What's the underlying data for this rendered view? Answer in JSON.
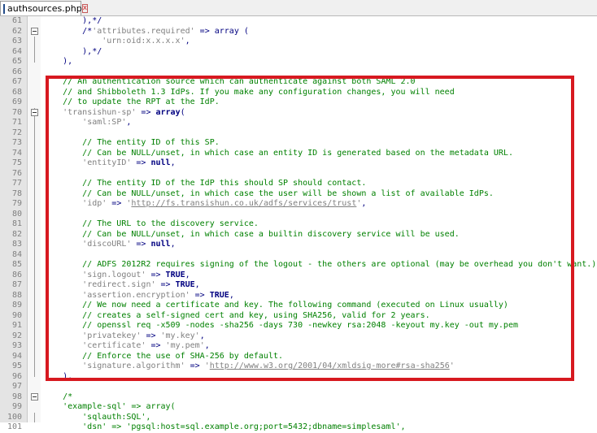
{
  "tab": {
    "title": "authsources.php",
    "close_glyph": "x"
  },
  "lines": [
    {
      "n": "61",
      "fold": "",
      "parts": [
        {
          "t": "        ),*/",
          "c": "op"
        }
      ]
    },
    {
      "n": "62",
      "fold": "open",
      "parts": [
        {
          "t": "        /*",
          "c": "op"
        },
        {
          "t": "'attributes.required'",
          "c": "str"
        },
        {
          "t": " => array (",
          "c": "op"
        }
      ]
    },
    {
      "n": "63",
      "fold": "",
      "parts": [
        {
          "t": "            ",
          "c": ""
        },
        {
          "t": "'urn:oid:x.x.x.x'",
          "c": "str"
        },
        {
          "t": ",",
          "c": "op"
        }
      ]
    },
    {
      "n": "64",
      "fold": "",
      "parts": [
        {
          "t": "        ),*/",
          "c": "op"
        }
      ]
    },
    {
      "n": "65",
      "fold": "",
      "parts": [
        {
          "t": "    ),",
          "c": "op"
        }
      ]
    },
    {
      "n": "66",
      "fold": "",
      "parts": []
    },
    {
      "n": "67",
      "fold": "",
      "parts": [
        {
          "t": "    // An authentication source which can authenticate against both SAML 2.0",
          "c": "cmt"
        }
      ]
    },
    {
      "n": "68",
      "fold": "",
      "parts": [
        {
          "t": "    // and Shibboleth 1.3 IdPs. If you make any configuration changes, you will need",
          "c": "cmt"
        }
      ]
    },
    {
      "n": "69",
      "fold": "",
      "parts": [
        {
          "t": "    // to update the RPT at the IdP.",
          "c": "cmt"
        }
      ]
    },
    {
      "n": "70",
      "fold": "open",
      "parts": [
        {
          "t": "    ",
          "c": ""
        },
        {
          "t": "'transishun-sp'",
          "c": "str"
        },
        {
          "t": " => ",
          "c": "op"
        },
        {
          "t": "array",
          "c": "kw"
        },
        {
          "t": "(",
          "c": "op"
        }
      ]
    },
    {
      "n": "71",
      "fold": "",
      "parts": [
        {
          "t": "        ",
          "c": ""
        },
        {
          "t": "'saml:SP'",
          "c": "str"
        },
        {
          "t": ",",
          "c": "op"
        }
      ]
    },
    {
      "n": "72",
      "fold": "",
      "parts": []
    },
    {
      "n": "73",
      "fold": "",
      "parts": [
        {
          "t": "        // The entity ID of this SP.",
          "c": "cmt"
        }
      ]
    },
    {
      "n": "74",
      "fold": "",
      "parts": [
        {
          "t": "        // Can be NULL/unset, in which case an entity ID is generated based on the metadata URL.",
          "c": "cmt"
        }
      ]
    },
    {
      "n": "75",
      "fold": "",
      "parts": [
        {
          "t": "        ",
          "c": ""
        },
        {
          "t": "'entityID'",
          "c": "str"
        },
        {
          "t": " => ",
          "c": "op"
        },
        {
          "t": "null",
          "c": "kw"
        },
        {
          "t": ",",
          "c": "op"
        }
      ]
    },
    {
      "n": "76",
      "fold": "",
      "parts": []
    },
    {
      "n": "77",
      "fold": "",
      "parts": [
        {
          "t": "        // The entity ID of the IdP this should SP should contact.",
          "c": "cmt"
        }
      ]
    },
    {
      "n": "78",
      "fold": "",
      "parts": [
        {
          "t": "        // Can be NULL/unset, in which case the user will be shown a list of available IdPs.",
          "c": "cmt"
        }
      ]
    },
    {
      "n": "79",
      "fold": "",
      "parts": [
        {
          "t": "        ",
          "c": ""
        },
        {
          "t": "'idp'",
          "c": "str"
        },
        {
          "t": " => ",
          "c": "op"
        },
        {
          "t": "'",
          "c": "str"
        },
        {
          "t": "http://fs.transishun.co.uk/adfs/services/trust",
          "c": "url"
        },
        {
          "t": "'",
          "c": "str"
        },
        {
          "t": ",",
          "c": "op"
        }
      ]
    },
    {
      "n": "80",
      "fold": "",
      "parts": []
    },
    {
      "n": "81",
      "fold": "",
      "parts": [
        {
          "t": "        // The URL to the discovery service.",
          "c": "cmt"
        }
      ]
    },
    {
      "n": "82",
      "fold": "",
      "parts": [
        {
          "t": "        // Can be NULL/unset, in which case a builtin discovery service will be used.",
          "c": "cmt"
        }
      ]
    },
    {
      "n": "83",
      "fold": "",
      "parts": [
        {
          "t": "        ",
          "c": ""
        },
        {
          "t": "'discoURL'",
          "c": "str"
        },
        {
          "t": " => ",
          "c": "op"
        },
        {
          "t": "null",
          "c": "kw"
        },
        {
          "t": ",",
          "c": "op"
        }
      ]
    },
    {
      "n": "84",
      "fold": "",
      "parts": []
    },
    {
      "n": "85",
      "fold": "",
      "parts": [
        {
          "t": "        // ADFS 2012R2 requires signing of the logout - the others are optional (may be overhead you don't want.)",
          "c": "cmt"
        }
      ]
    },
    {
      "n": "86",
      "fold": "",
      "parts": [
        {
          "t": "        ",
          "c": ""
        },
        {
          "t": "'sign.logout'",
          "c": "str"
        },
        {
          "t": " => ",
          "c": "op"
        },
        {
          "t": "TRUE",
          "c": "kw"
        },
        {
          "t": ",",
          "c": "op"
        }
      ]
    },
    {
      "n": "87",
      "fold": "",
      "parts": [
        {
          "t": "        ",
          "c": ""
        },
        {
          "t": "'redirect.sign'",
          "c": "str"
        },
        {
          "t": " => ",
          "c": "op"
        },
        {
          "t": "TRUE",
          "c": "kw"
        },
        {
          "t": ",",
          "c": "op"
        }
      ]
    },
    {
      "n": "88",
      "fold": "",
      "parts": [
        {
          "t": "        ",
          "c": ""
        },
        {
          "t": "'assertion.encryption'",
          "c": "str"
        },
        {
          "t": " => ",
          "c": "op"
        },
        {
          "t": "TRUE",
          "c": "kw"
        },
        {
          "t": ",",
          "c": "op"
        }
      ]
    },
    {
      "n": "89",
      "fold": "",
      "parts": [
        {
          "t": "        // We now need a certificate and key. The following command (executed on Linux usually)",
          "c": "cmt"
        }
      ]
    },
    {
      "n": "90",
      "fold": "",
      "parts": [
        {
          "t": "        // creates a self-signed cert and key, using SHA256, valid for 2 years.",
          "c": "cmt"
        }
      ]
    },
    {
      "n": "91",
      "fold": "",
      "parts": [
        {
          "t": "        // openssl req -x509 -nodes -sha256 -days 730 -newkey rsa:2048 -keyout my.key -out my.pem",
          "c": "cmt"
        }
      ]
    },
    {
      "n": "92",
      "fold": "",
      "parts": [
        {
          "t": "        ",
          "c": ""
        },
        {
          "t": "'privatekey'",
          "c": "str"
        },
        {
          "t": " => ",
          "c": "op"
        },
        {
          "t": "'my.key'",
          "c": "str"
        },
        {
          "t": ",",
          "c": "op"
        }
      ]
    },
    {
      "n": "93",
      "fold": "",
      "parts": [
        {
          "t": "        ",
          "c": ""
        },
        {
          "t": "'certificate'",
          "c": "str"
        },
        {
          "t": " => ",
          "c": "op"
        },
        {
          "t": "'my.pem'",
          "c": "str"
        },
        {
          "t": ",",
          "c": "op"
        }
      ]
    },
    {
      "n": "94",
      "fold": "",
      "parts": [
        {
          "t": "        // Enforce the use of SHA-256 by default.",
          "c": "cmt"
        }
      ]
    },
    {
      "n": "95",
      "fold": "",
      "parts": [
        {
          "t": "        ",
          "c": ""
        },
        {
          "t": "'signature.algorithm'",
          "c": "str"
        },
        {
          "t": " => ",
          "c": "op"
        },
        {
          "t": "'",
          "c": "str"
        },
        {
          "t": "http://www.w3.org/2001/04/xmldsig-more#rsa-sha256",
          "c": "url"
        },
        {
          "t": "'",
          "c": "str"
        }
      ]
    },
    {
      "n": "96",
      "fold": "",
      "parts": [
        {
          "t": "    ),",
          "c": "op"
        }
      ]
    },
    {
      "n": "97",
      "fold": "",
      "parts": []
    },
    {
      "n": "98",
      "fold": "open",
      "parts": [
        {
          "t": "    /*",
          "c": "cmt"
        }
      ]
    },
    {
      "n": "99",
      "fold": "",
      "parts": [
        {
          "t": "    ",
          "c": ""
        },
        {
          "t": "'example-sql'",
          "c": "cmt"
        },
        {
          "t": " => array(",
          "c": "cmt"
        }
      ]
    },
    {
      "n": "100",
      "fold": "",
      "parts": [
        {
          "t": "        'sqlauth:SQL',",
          "c": "cmt"
        }
      ]
    },
    {
      "n": "101",
      "fold": "",
      "parts": [
        {
          "t": "        'dsn' => 'pgsql:host=sql.example.org;port=5432;dbname=simplesaml',",
          "c": "cmt"
        }
      ]
    }
  ],
  "highlight": {
    "color": "#d71920"
  }
}
